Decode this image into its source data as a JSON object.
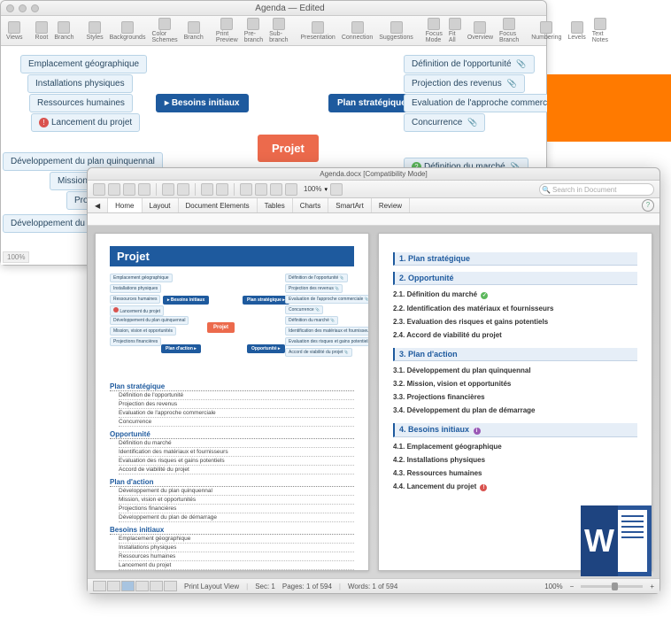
{
  "win1": {
    "title": "Agenda — Edited",
    "toolbar": [
      "Views",
      "Root",
      "Branch",
      "Styles",
      "Backgrounds",
      "Color Schemes",
      "Branch",
      "Print Preview",
      "Pre-branch",
      "Sub-branch",
      "Presentation",
      "Connection",
      "Suggestions",
      "Focus Mode",
      "Fit All",
      "Overview",
      "Focus Branch",
      "Numbering",
      "Levels",
      "Text Notes"
    ],
    "zoom": "100%",
    "root": "Projet",
    "branches": {
      "left1": "Besoins initiaux",
      "right1": "Plan stratégique"
    },
    "left_leaves": [
      "Emplacement géographique",
      "Installations physiques",
      "Ressources humaines",
      "Lancement du projet",
      "Développement du plan quinquennal",
      "Mission, vi",
      "Pro",
      "Développement du"
    ],
    "left_leaf_badge_index": 3,
    "right_leaves": [
      "Définition de l'opportunité",
      "Projection des revenus",
      "Evaluation de l'approche commerciale",
      "Concurrence",
      "Définition du marché"
    ]
  },
  "win2": {
    "title": "Agenda.docx [Compatibility Mode]",
    "zoom": "100%",
    "search_placeholder": "Search in Document",
    "tabs": [
      "Home",
      "Layout",
      "Document Elements",
      "Tables",
      "Charts",
      "SmartArt",
      "Review"
    ],
    "page1": {
      "title": "Projet",
      "mini": {
        "root": "Projet",
        "b1": "Besoins initiaux",
        "b2": "Plan stratégique",
        "b3": "Plan d'action",
        "b4": "Opportunité",
        "ll": [
          "Emplacement géographique",
          "Installations physiques",
          "Ressources humaines",
          "Lancement du projet",
          "Développement du plan quinquennal",
          "Mission, vision et opportunités",
          "Projections financières"
        ],
        "rl": [
          "Définition de l'opportunité",
          "Projection des revenus",
          "Evaluation de l'approche commerciale",
          "Concurrence",
          "Définition du marché",
          "Identification des matériaux et fournisseurs",
          "Evaluation des risques et gains potentiels",
          "Accord de viabilité du projet"
        ]
      },
      "toc": [
        {
          "h": "Plan stratégique",
          "items": [
            "Définition de l'opportunité",
            "Projection des revenus",
            "Evaluation de l'approche commerciale",
            "Concurrence"
          ]
        },
        {
          "h": "Opportunité",
          "items": [
            "Définition du marché",
            "Identification des matériaux et fournisseurs",
            "Evaluation des risques et gains potentiels",
            "Accord de viabilité du projet"
          ]
        },
        {
          "h": "Plan d'action",
          "items": [
            "Développement du plan quinquennal",
            "Mission, vision et opportunités",
            "Projections financières",
            "Développement du plan de démarrage"
          ]
        },
        {
          "h": "Besoins initiaux",
          "items": [
            "Emplacement géographique",
            "Installations physiques",
            "Ressources humaines",
            "Lancement du projet"
          ]
        }
      ]
    },
    "page2": {
      "sections": [
        {
          "num": "1.",
          "title": "Plan stratégique",
          "items": []
        },
        {
          "num": "2.",
          "title": "Opportunité",
          "items": [
            {
              "n": "2.1.",
              "t": "Définition du marché",
              "badge": "green"
            },
            {
              "n": "2.2.",
              "t": "Identification des matériaux et fournisseurs"
            },
            {
              "n": "2.3.",
              "t": "Evaluation des risques et gains potentiels"
            },
            {
              "n": "2.4.",
              "t": "Accord de viabilité du projet"
            }
          ]
        },
        {
          "num": "3.",
          "title": "Plan d'action",
          "items": [
            {
              "n": "3.1.",
              "t": "Développement du plan quinquennal"
            },
            {
              "n": "3.2.",
              "t": "Mission, vision et opportunités"
            },
            {
              "n": "3.3.",
              "t": "Projections financières"
            },
            {
              "n": "3.4.",
              "t": "Développement du plan de démarrage"
            }
          ]
        },
        {
          "num": "4.",
          "title": "Besoins initiaux",
          "badge": "purple",
          "items": [
            {
              "n": "4.1.",
              "t": "Emplacement géographique"
            },
            {
              "n": "4.2.",
              "t": "Installations physiques"
            },
            {
              "n": "4.3.",
              "t": "Ressources humaines"
            },
            {
              "n": "4.4.",
              "t": "Lancement du projet",
              "badge": "red"
            }
          ]
        }
      ]
    },
    "status": {
      "view_label": "Print Layout View",
      "sec": "Sec: 1",
      "pages": "Pages: 1 of 594",
      "words": "Words: 1 of 594",
      "zoom": "100%"
    }
  }
}
